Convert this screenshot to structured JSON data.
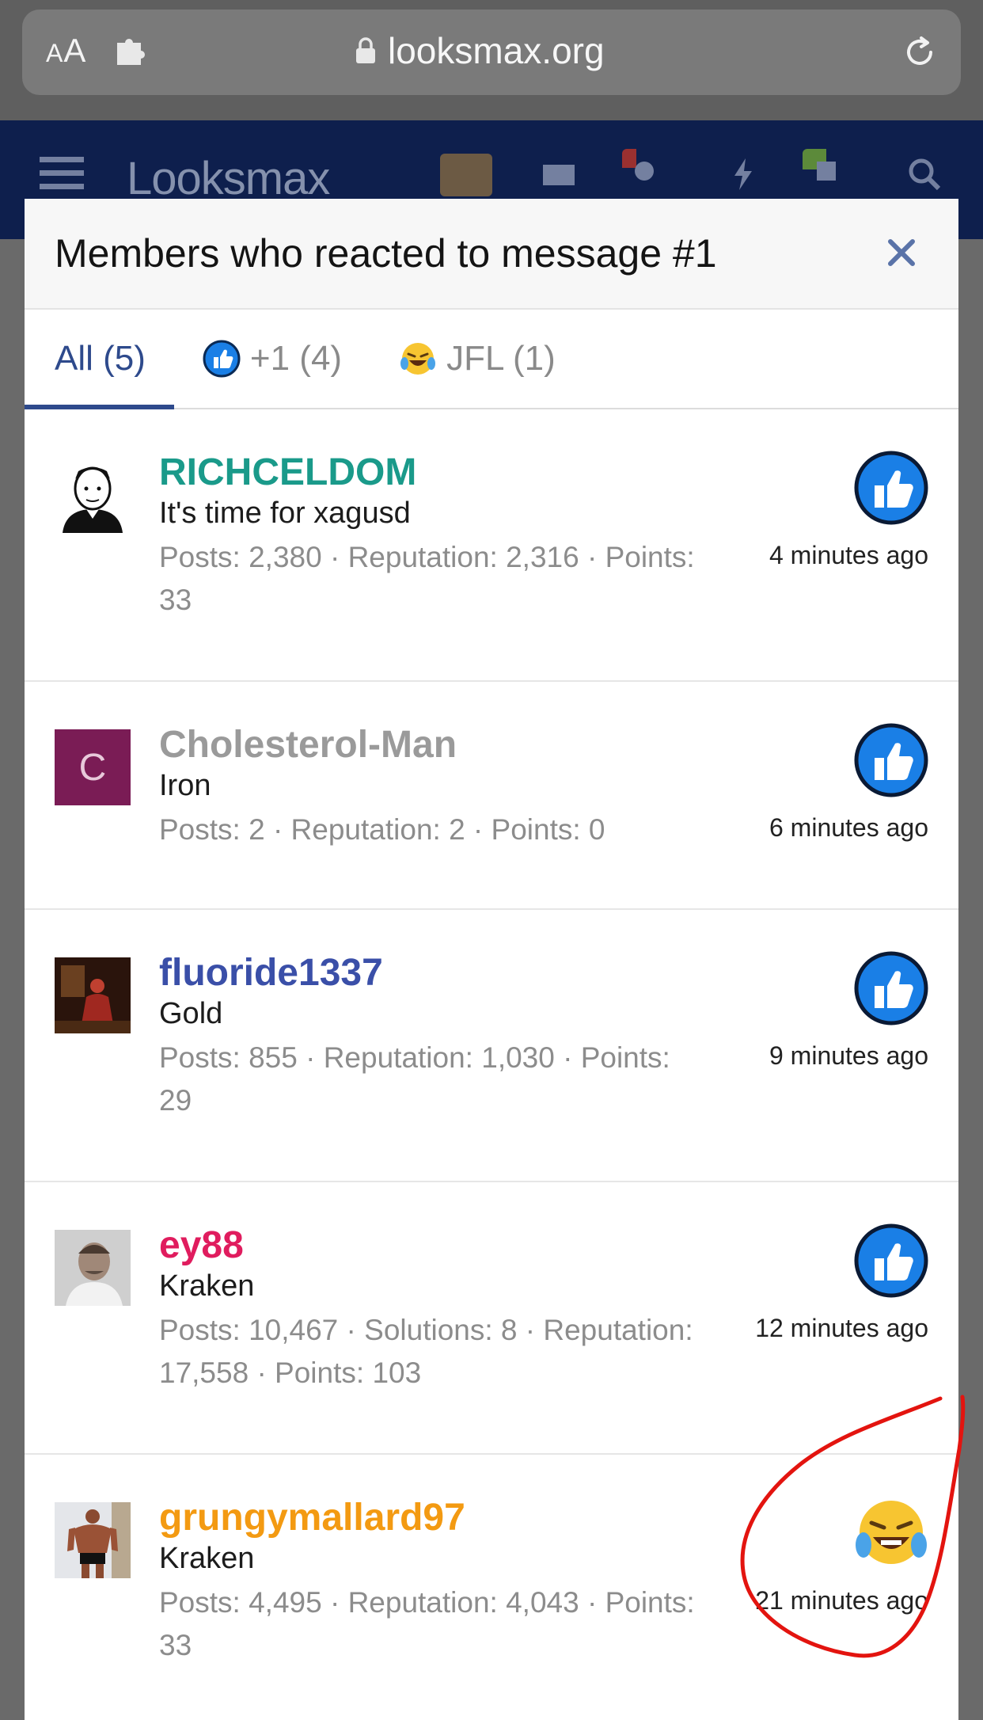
{
  "browser": {
    "aa_label_large": "A",
    "aa_label_small": "A",
    "url": "looksmax.org"
  },
  "forum_header": {
    "logo_text": "Looksmax"
  },
  "modal": {
    "title": "Members who reacted to message #1",
    "tabs": [
      {
        "label": "All (5)",
        "active": true
      },
      {
        "label": "+1 (4)",
        "icon": "thumbs-up-icon",
        "active": false
      },
      {
        "label": "JFL (1)",
        "icon": "laughing-crying-emoji-icon",
        "active": false
      }
    ]
  },
  "reactions": [
    {
      "username": "RICHCELDOM",
      "user_color": "#1a9a8a",
      "user_title": "It's time for xagusd",
      "stats_line1": "Posts: 2,380 · Reputation: 2,316 · Points:",
      "stats_line2": "33",
      "reaction": "thumbs-up-icon",
      "time": "4 minutes ago",
      "avatar": "wojak-suit-avatar"
    },
    {
      "username": "Cholesterol-Man",
      "user_color": "#9a9a9a",
      "user_title": "Iron",
      "stats_line1": "Posts: 2 · Reputation: 2 · Points: 0",
      "stats_line2": "",
      "reaction": "thumbs-up-icon",
      "time": "6 minutes ago",
      "avatar_letter": "C",
      "avatar_color": "#7a1c55"
    },
    {
      "username": "fluoride1337",
      "user_color": "#3a4fa8",
      "user_title": "Gold",
      "stats_line1": "Posts: 855 · Reputation: 1,030 · Points:",
      "stats_line2": "29",
      "reaction": "thumbs-up-icon",
      "time": "9 minutes ago",
      "avatar": "painting-avatar"
    },
    {
      "username": "ey88",
      "user_color": "#e01c5e",
      "user_title": "Kraken",
      "stats_line1": "Posts: 10,467 · Solutions: 8 · Reputation:",
      "stats_line2": "17,558 · Points: 103",
      "reaction": "thumbs-up-icon",
      "time": "12 minutes ago",
      "avatar": "man-photo-avatar"
    },
    {
      "username": "grungymallard97",
      "user_color": "#f39a12",
      "user_title": "Kraken",
      "stats_line1": "Posts: 4,495 · Reputation: 4,043 · Points:",
      "stats_line2": "33",
      "reaction": "laughing-crying-emoji-icon",
      "time": "21 minutes ago",
      "avatar": "bodybuilder-avatar"
    }
  ],
  "colors": {
    "accent": "#2e4a8c",
    "thumb_blue": "#1a7fe6",
    "annotation_red": "#e3140f"
  }
}
